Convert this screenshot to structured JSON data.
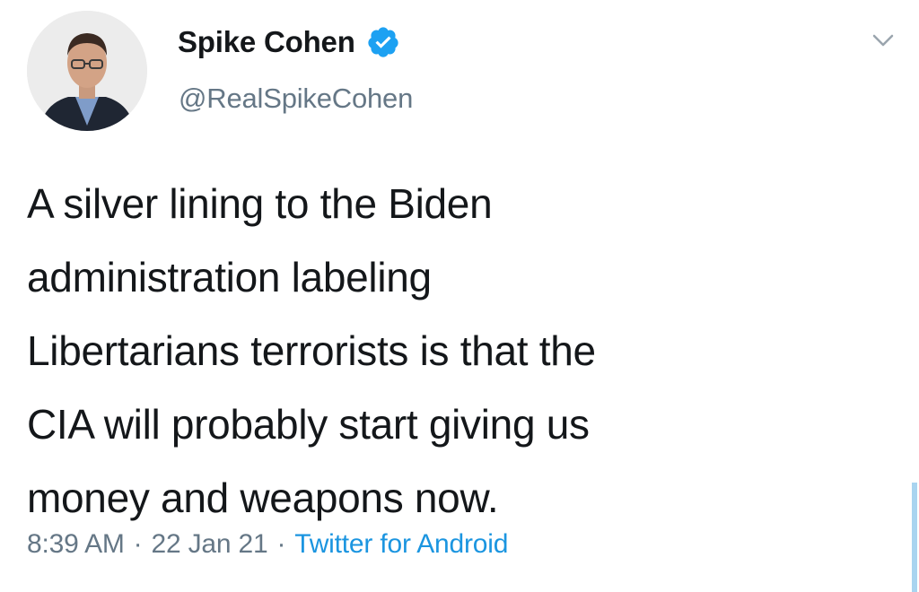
{
  "author": {
    "display_name": "Spike Cohen",
    "handle": "@RealSpikeCohen",
    "verified": true,
    "avatar_icon": "profile-photo"
  },
  "menu": {
    "icon": "chevron-down-icon"
  },
  "tweet": {
    "lines": [
      "A silver lining to the Biden",
      "administration labeling",
      "Libertarians terrorists is that the",
      "CIA will probably start giving us",
      "money and weapons now."
    ]
  },
  "meta": {
    "time": "8:39 AM",
    "separator": "·",
    "date": "22 Jan 21",
    "source": "Twitter for Android"
  },
  "colors": {
    "text": "#14171a",
    "secondary": "#657786",
    "link": "#1b95e0",
    "verified": "#1da1f2"
  }
}
